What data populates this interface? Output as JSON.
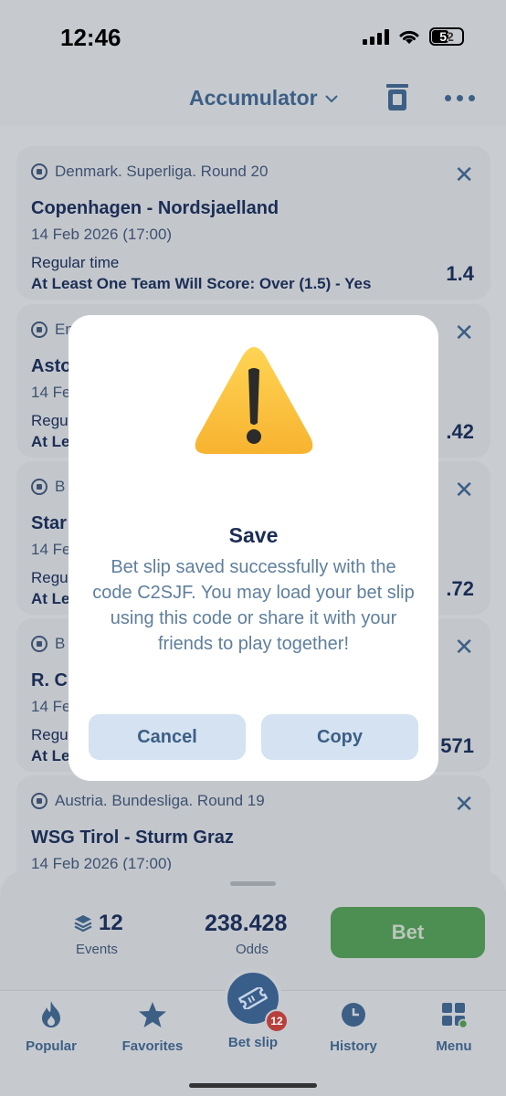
{
  "status_bar": {
    "time": "12:46",
    "battery": "52"
  },
  "header": {
    "title": "Accumulator"
  },
  "cards": [
    {
      "league": "Denmark. Superliga. Round 20",
      "match": "Copenhagen - Nordsjaelland",
      "date": "14 Feb 2026 (17:00)",
      "period": "Regular time",
      "bet": "At Least One Team Will Score: Over (1.5) - Yes",
      "odd": "1.4"
    },
    {
      "league": "En",
      "match": "Asto",
      "date": "14 Fe",
      "period": "Regul",
      "bet": "At Le",
      "odd": ".42"
    },
    {
      "league": "B",
      "match": "Star",
      "date": "14 Fe",
      "period": "Regul",
      "bet": "At Le",
      "odd": ".72"
    },
    {
      "league": "B",
      "match": "R. C",
      "date": "14 Fe",
      "period": "Regul",
      "bet": "At Le",
      "odd": "571"
    },
    {
      "league": "Austria. Bundesliga. Round 19",
      "match": "WSG Tirol - Sturm Graz",
      "date": "14 Feb 2026 (17:00)",
      "period": "",
      "bet": "",
      "odd": ""
    }
  ],
  "summary": {
    "events_count": "12",
    "events_label": "Events",
    "odds_value": "238.428",
    "odds_label": "Odds",
    "bet_label": "Bet"
  },
  "tabs": [
    {
      "label": "Popular",
      "icon": "flame-icon"
    },
    {
      "label": "Favorites",
      "icon": "star-icon"
    },
    {
      "label": "Bet slip",
      "icon": "ticket-icon",
      "badge": "12"
    },
    {
      "label": "History",
      "icon": "clock-icon"
    },
    {
      "label": "Menu",
      "icon": "grid-icon"
    }
  ],
  "modal": {
    "title": "Save",
    "message": "Bet slip saved successfully with the code C2SJF. You may load your bet slip using this code or share it with your friends to play together!",
    "cancel_label": "Cancel",
    "copy_label": "Copy"
  },
  "colors": {
    "accent": "#3d5f85",
    "bet_green": "#4d8f52",
    "badge_red": "#b8403c",
    "modal_button": "#d4e2f1"
  }
}
